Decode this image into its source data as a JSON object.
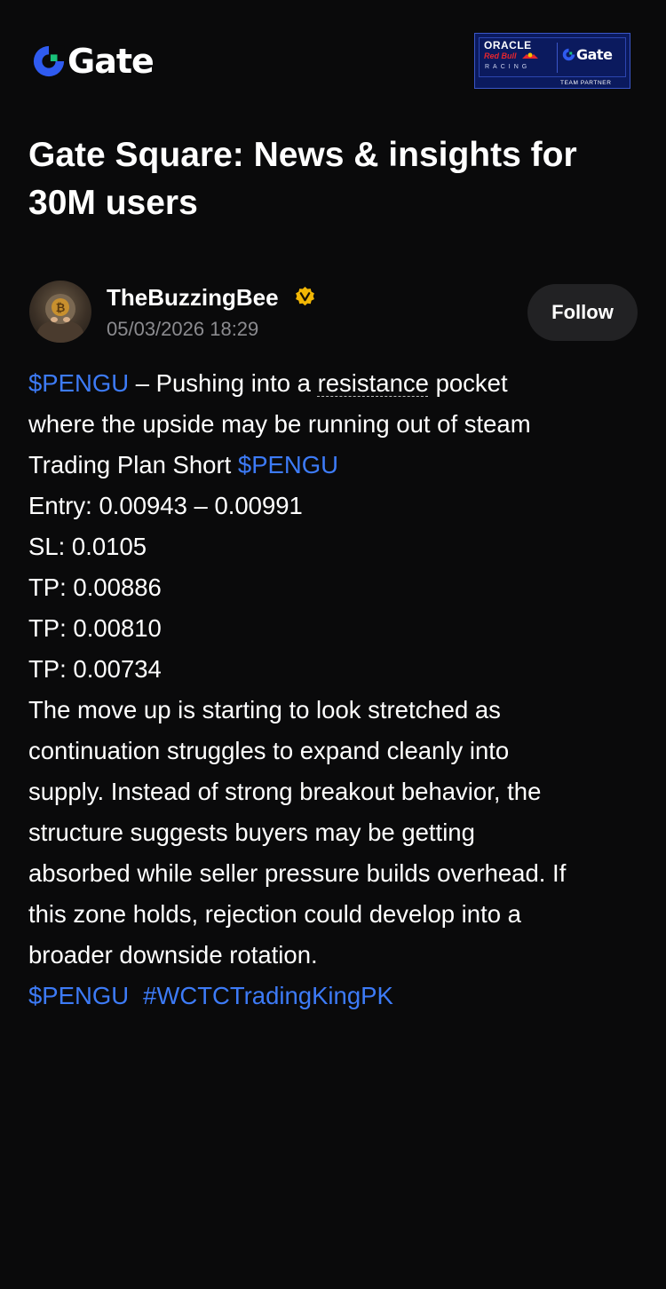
{
  "brand": {
    "logo_text": "Gate",
    "logo_color": "#2f5bf0",
    "logo_accent": "#19c27a"
  },
  "partner_badge": {
    "oracle": "ORACLE",
    "red_bull": "Red Bull",
    "racing": "RACING",
    "gate": "Gate",
    "team_partner": "TEAM PARTNER"
  },
  "page": {
    "title": "Gate Square: News & insights for 30M users"
  },
  "post": {
    "author": {
      "name": "TheBuzzingBee",
      "verified": true
    },
    "date": "05/03/2026 18:29",
    "follow_label": "Follow",
    "body": {
      "line1_tag": "$PENGU",
      "line1_text_a": " – Pushing into a ",
      "line1_underlined": "resistance",
      "line1_text_b": " pocket",
      "line2": "where the upside may be running out of steam",
      "line3_text": "Trading Plan Short ",
      "line3_tag": "$PENGU",
      "entry": "Entry: 0.00943 – 0.00991",
      "sl": "SL: 0.0105",
      "tp1": "TP: 0.00886",
      "tp2": "TP: 0.00810",
      "tp3": "TP: 0.00734",
      "para": [
        "The move up is starting to look stretched as",
        "continuation struggles to expand cleanly into",
        "supply. Instead of strong breakout behavior, the",
        "structure suggests buyers may be getting",
        "absorbed while seller pressure builds overhead. If",
        "this zone holds, rejection could develop into a",
        "broader downside rotation."
      ],
      "footer_tags": [
        "$PENGU",
        "#WCTCTradingKingPK"
      ]
    }
  },
  "colors": {
    "background": "#0a0a0b",
    "link": "#3d7bf7",
    "muted": "#8b8b8f",
    "verified": "#f2b705",
    "follow_bg": "#222224"
  }
}
